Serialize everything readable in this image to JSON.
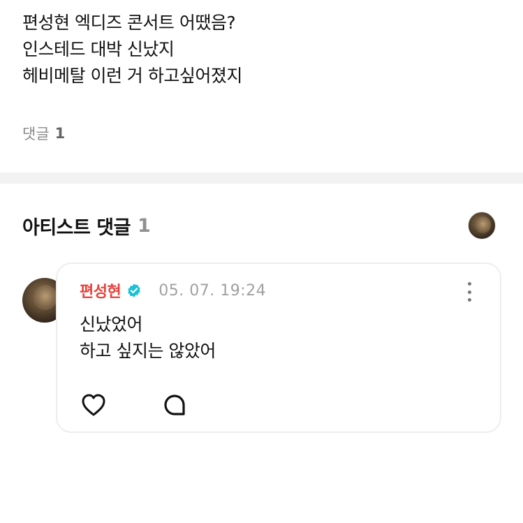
{
  "post": {
    "lines": [
      "편성현 엑디즈 콘서트 어땠음?",
      "인스테드 대박 신났지",
      "헤비메탈 이런 거 하고싶어졌지"
    ]
  },
  "comment_summary": {
    "label": "댓글",
    "count": "1"
  },
  "artist_section": {
    "title": "아티스트 댓글",
    "count": "1"
  },
  "comment": {
    "author": "편성현",
    "timestamp": "05. 07. 19:24",
    "lines": [
      "신났었어",
      "하고 싶지는 않았어"
    ]
  },
  "icons": {
    "verified": "verified-badge-icon",
    "more": "more-vertical-icon",
    "like": "heart-icon",
    "reply": "speech-bubble-icon"
  },
  "colors": {
    "author_name": "#e8413c",
    "verified_badge": "#19c2d4",
    "divider": "#f2f2f2",
    "muted_text": "#8a8a8a"
  }
}
